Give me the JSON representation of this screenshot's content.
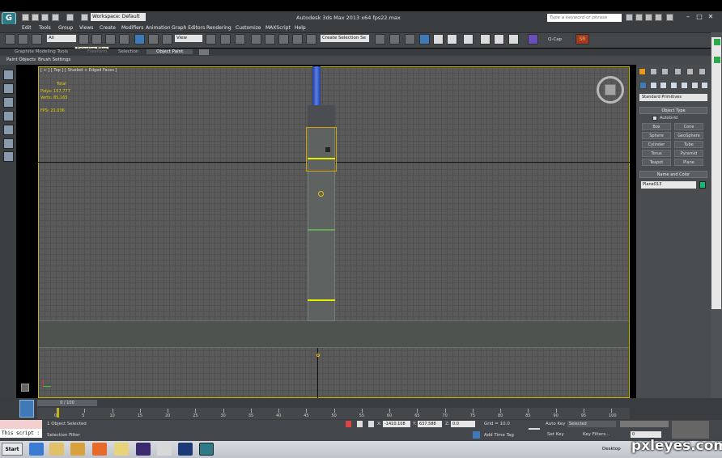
{
  "titlebar": {
    "workspace": "Workspace: Default",
    "app_title": "Autodesk 3ds Max 2013 x64     fps22.max",
    "search_placeholder": "Type a keyword or phrase"
  },
  "menu": [
    "Edit",
    "Tools",
    "Group",
    "Views",
    "Create",
    "Modifiers",
    "Animation",
    "Graph Editors",
    "Rendering",
    "Customize",
    "MAXScript",
    "Help"
  ],
  "toolbar": {
    "filter_value": "All",
    "view_value": "View",
    "selection_set": "Create Selection Se",
    "qcap_label": "Q-Cap",
    "sr_label": "SR",
    "tooltip": "Selection Filter"
  },
  "ribbon": {
    "tabs": [
      "Graphite Modeling Tools",
      "Freeform",
      "Selection",
      "Object Paint"
    ],
    "active_tab": "Object Paint",
    "sub_buttons": [
      "Paint Objects",
      "Brush Settings"
    ]
  },
  "viewport": {
    "label": "[ + ] [ Top ] [ Shaded + Edged Faces ]",
    "stats": {
      "total_label": "Total",
      "polys": "Polys:  157,777",
      "verts": "Verts:  85,165",
      "fps": "FPS:    21.036"
    }
  },
  "command_panel": {
    "category": "Standard Primitives",
    "object_type_title": "Object Type",
    "autogrid_label": "AutoGrid",
    "primitives": [
      "Box",
      "Cone",
      "Sphere",
      "GeoSphere",
      "Cylinder",
      "Tube",
      "Torus",
      "Pyramid",
      "Teapot",
      "Plane"
    ],
    "name_color_title": "Name and Color",
    "object_name": "Plane013",
    "object_color": "#0fb87a"
  },
  "timeline": {
    "frame": "0 / 100",
    "ticks": [
      "0",
      "5",
      "10",
      "15",
      "20",
      "25",
      "30",
      "35",
      "40",
      "45",
      "50",
      "55",
      "60",
      "65",
      "70",
      "75",
      "80",
      "85",
      "90",
      "95",
      "100"
    ]
  },
  "status": {
    "maxscript": "This script :",
    "selected_count": "1 Object Selected",
    "prompt": "Selection Filter",
    "x_value": "-1410.108",
    "y_value": "637.588",
    "z_value": "0.0",
    "grid": "Grid = 10.0",
    "add_time_tag": "Add Time Tag",
    "auto_key": "Auto Key",
    "selected_dropdown": "Selected",
    "set_key": "Set Key",
    "key_filters": "Key Filters...",
    "frame_field": "0"
  },
  "taskbar": {
    "start_label": "Start",
    "desktop_label": "Desktop",
    "watermark": "pxleyes.com"
  }
}
